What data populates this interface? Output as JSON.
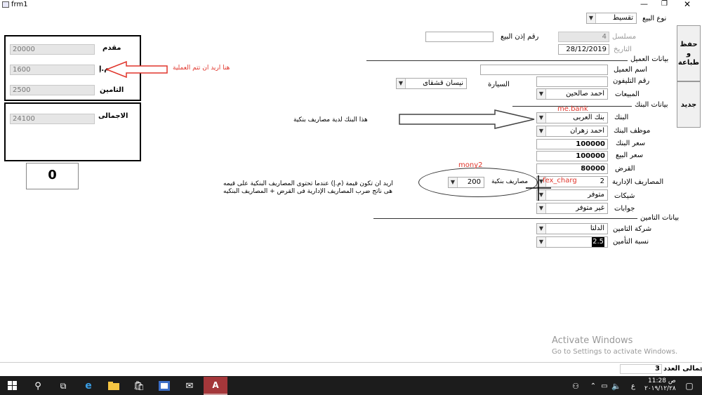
{
  "window": {
    "title": "frm1"
  },
  "top": {
    "sale_type_label": "نوع البيع",
    "sale_type_value": "تقسيط"
  },
  "side_buttons": {
    "save_print": "حفظ\nو\nطباعة",
    "new": "جديد"
  },
  "header_fields": {
    "serial_label": "مسلسل",
    "serial_value": "4",
    "date_label": "التاريخ",
    "date_value": "28/12/2019",
    "permit_label": "رقم إذن البيع",
    "permit_value": ""
  },
  "client_section": {
    "title": "بيانات العميل",
    "name_label": "اسم العميل",
    "name_value": "",
    "phone_label": "رقم التليفون",
    "phone_value": "",
    "car_label": "السيارة",
    "car_value": "نيسان قشقاى",
    "sales_label": "المبيعات",
    "sales_value": "احمد صالحين"
  },
  "bank_section": {
    "title": "بيانات البنك",
    "bank_label": "البنك",
    "bank_value": "بنك العربى",
    "employee_label": "موظف البنك",
    "employee_value": "احمد زهران",
    "bank_price_label": "سعر البنك",
    "bank_price_value": "100000",
    "sale_price_label": "سعر البيع",
    "sale_price_value": "100000",
    "loan_label": "القرض",
    "loan_value": "80000",
    "admin_fees_label": "المصاريف الإدارية",
    "admin_fees_value": "2",
    "bank_fees_label": "مصاريف بنكية",
    "bank_fees_value": "200",
    "checks_label": "شيكات",
    "checks_value": "متوفر",
    "letters_label": "جوابات",
    "letters_value": "غير متوفر"
  },
  "insurance_section": {
    "title": "بيانات التامين",
    "company_label": "شركة التامين",
    "company_value": "الدلتا",
    "rate_label": "نسبة التأمين",
    "rate_value": "2.5"
  },
  "summary_box": {
    "down_label": "مقدم",
    "down_value": "20000",
    "m_label": "م.إ",
    "m_value": "1600",
    "ins_label": "التامين",
    "ins_value": "2500",
    "total_label": "الاجمالى",
    "total_value": "24100"
  },
  "zero_box": "0",
  "annotations": {
    "m_note": "هنا اريد ان تتم العملية",
    "bank_note": "هذا البنك لدية مصاريف بنكية",
    "me_bank": "me.bank",
    "mony2": "mony2",
    "fex_charg": "fex_charg",
    "formula_line1": "اريد ان تكون قيمة (م.إ) عندما تحتوى المصاريف البنكية على قيمه",
    "formula_line2": "هى ناتج ضرب المصاريف الإدارية فى القرض  +  المصاريف البنكيه"
  },
  "watermark": {
    "line1": "Activate Windows",
    "line2": "Go to Settings to activate Windows."
  },
  "status": {
    "count_label": "اجمالى العدد",
    "count_value": "3"
  },
  "taskbar": {
    "time": "11:28 ص",
    "date": "٢٠١٩/١٢/٢٨",
    "lang": "ع"
  },
  "colors": {
    "accent": "#e0352b",
    "taskbar": "#1c1c1c"
  }
}
